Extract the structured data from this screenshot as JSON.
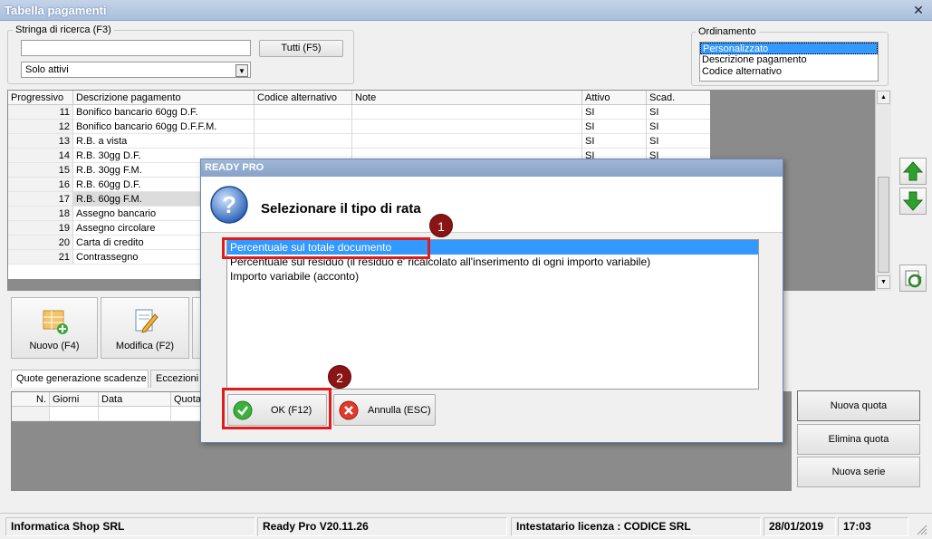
{
  "window": {
    "title": "Tabella pagamenti"
  },
  "search": {
    "legend": "Stringa di ricerca (F3)",
    "value": "",
    "tutti_label": "Tutti (F5)",
    "filter_selected": "Solo attivi"
  },
  "ordinamento": {
    "legend": "Ordinamento",
    "options": [
      "Personalizzato",
      "Descrizione pagamento",
      "Codice alternativo"
    ]
  },
  "grid": {
    "headers": [
      "Progressivo",
      "Descrizione pagamento",
      "Codice alternativo",
      "Note",
      "Attivo",
      "Scad."
    ],
    "rows": [
      {
        "n": "11",
        "desc": "Bonifico bancario 60gg D.F.",
        "att": "SI",
        "scad": "SI"
      },
      {
        "n": "12",
        "desc": "Bonifico bancario 60gg D.F.F.M.",
        "att": "SI",
        "scad": "SI"
      },
      {
        "n": "13",
        "desc": "R.B. a vista",
        "att": "SI",
        "scad": "SI"
      },
      {
        "n": "14",
        "desc": "R.B. 30gg D.F.",
        "att": "SI",
        "scad": "SI"
      },
      {
        "n": "15",
        "desc": "R.B. 30gg F.M.",
        "att": "",
        "scad": ""
      },
      {
        "n": "16",
        "desc": "R.B. 60gg D.F.",
        "att": "",
        "scad": ""
      },
      {
        "n": "17",
        "desc": "R.B. 60gg F.M.",
        "att": "",
        "scad": ""
      },
      {
        "n": "18",
        "desc": "Assegno bancario",
        "att": "",
        "scad": ""
      },
      {
        "n": "19",
        "desc": "Assegno circolare",
        "att": "",
        "scad": ""
      },
      {
        "n": "20",
        "desc": "Carta di credito",
        "att": "",
        "scad": ""
      },
      {
        "n": "21",
        "desc": "Contrassegno",
        "att": "",
        "scad": ""
      }
    ]
  },
  "toolbar": {
    "nuovo": "Nuovo (F4)",
    "modifica": "Modifica (F2)"
  },
  "tabs": [
    "Quote generazione scadenze",
    "Eccezioni s"
  ],
  "quote_grid": {
    "headers": [
      "N.",
      "Giorni",
      "Data",
      "Quota"
    ]
  },
  "side_buttons": {
    "nuova_quota": "Nuova quota",
    "elimina_quota": "Elimina quota",
    "nuova_serie": "Nuova serie"
  },
  "dialog": {
    "title": "READY PRO",
    "question": "Selezionare il tipo di rata",
    "options": [
      "Percentuale sul totale documento",
      "Percentuale sul residuo (il residuo e' ricalcolato all'inserimento di ogni importo variabile)",
      "Importo variabile (acconto)"
    ],
    "ok_label": "OK (F12)",
    "cancel_label": "Annulla (ESC)"
  },
  "callouts": [
    "1",
    "2"
  ],
  "status": {
    "company": "Informatica Shop SRL",
    "version": "Ready Pro V20.11.26",
    "license": "Intestatario licenza : CODICE SRL",
    "date": "28/01/2019",
    "time": "17:03"
  },
  "colors": {
    "selection": "#3399ff",
    "callout": "#e01b1b",
    "badge": "#8b1414"
  }
}
